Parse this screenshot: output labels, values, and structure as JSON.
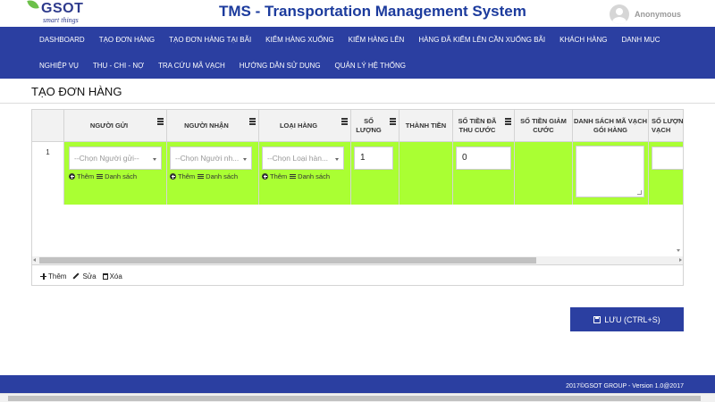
{
  "header": {
    "logo_text": "GSOT",
    "logo_tagline": "smart things",
    "title": "TMS - Transportation Management System",
    "username": "Anonymous"
  },
  "nav": {
    "row1": [
      "DASHBOARD",
      "TẠO ĐƠN HÀNG",
      "TẠO ĐƠN HÀNG TẠI BÃI",
      "KIỂM HÀNG XUỐNG",
      "KIỂM HÀNG LÊN",
      "HÀNG ĐÃ KIỂM LÊN CẦN XUỐNG BÃI",
      "KHÁCH HÀNG",
      "DANH MỤC"
    ],
    "row2": [
      "NGHIỆP VỤ",
      "THU - CHI - NỢ",
      "TRA CỨU MÃ VẠCH",
      "HƯỚNG DẪN SỬ DỤNG",
      "QUẢN LÝ HỆ THỐNG"
    ]
  },
  "page": {
    "title": "TẠO ĐƠN HÀNG"
  },
  "grid": {
    "columns": [
      "Người gửi",
      "Người nhận",
      "Loại hàng",
      "Số lượng",
      "Thành tiền",
      "Số tiền đã thu cước",
      "Số tiền giảm cước",
      "Danh sách mã vạch gói hàng",
      "Số lượng mã vạch"
    ],
    "row": {
      "number": "1",
      "sender_placeholder": "--Chọn Người gửi--",
      "receiver_placeholder": "--Chọn Người nh...",
      "type_placeholder": "--Chọn Loại hàn...",
      "add_label": "Thêm",
      "list_label": "Danh sách",
      "quantity": "1",
      "amount_paid": "0"
    },
    "footer": {
      "add": "Thêm",
      "edit": "Sửa",
      "delete": "Xóa"
    }
  },
  "save_button": "LƯU (CTRL+S)",
  "footer": {
    "copyright": "2017©GSOT GROUP - Version 1.0@2017"
  },
  "colors": {
    "nav_bg": "#2b3fa1",
    "title_blue": "#1c3b9d",
    "row_highlight": "#aaff33"
  }
}
